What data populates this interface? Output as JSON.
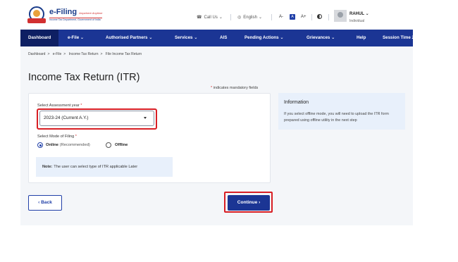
{
  "header": {
    "logo": {
      "title": "e-Filing",
      "tagline": "Anywhere Anytime",
      "subtitle": "Income Tax Department, Government of India"
    },
    "call_us": "Call Us",
    "language": "English",
    "font_controls": [
      "A-",
      "A",
      "A+"
    ],
    "user": {
      "name": "RAHUL",
      "type": "Individual"
    }
  },
  "nav": {
    "items": [
      {
        "label": "Dashboard",
        "active": true
      },
      {
        "label": "e-File",
        "dropdown": true
      },
      {
        "label": "Authorised Partners",
        "dropdown": true
      },
      {
        "label": "Services",
        "dropdown": true
      },
      {
        "label": "AIS"
      },
      {
        "label": "Pending Actions",
        "dropdown": true
      },
      {
        "label": "Grievances",
        "dropdown": true
      },
      {
        "label": "Help"
      },
      {
        "label": "Session Time"
      }
    ],
    "session_time_value": "2"
  },
  "breadcrumb": [
    "Dashboard",
    "e-File",
    "Income Tax Return",
    "File Income Tax Return"
  ],
  "page": {
    "title": "Income Tax Return (ITR)",
    "mandatory_note": "indicates mandatory fields"
  },
  "form": {
    "assessment_year_label": "Select Assessment year",
    "assessment_year_value": "2023-24 (Current A.Y.)",
    "mode_label": "Select Mode of Filing",
    "options": {
      "online": "Online",
      "online_hint": "(Recommended)",
      "offline": "Offline"
    },
    "selected_mode": "Online",
    "note_title": "Note:",
    "note_text": "The user can select type of ITR applicable Later"
  },
  "info": {
    "title": "Information",
    "body": "If you select offline mode, you will need to upload the ITR form prepared using offline utility in the next step"
  },
  "buttons": {
    "back": "Back",
    "continue": "Continue"
  },
  "colors": {
    "primary": "#1b3594",
    "highlight": "#d81e24",
    "info_bg": "#e8f0fb"
  }
}
